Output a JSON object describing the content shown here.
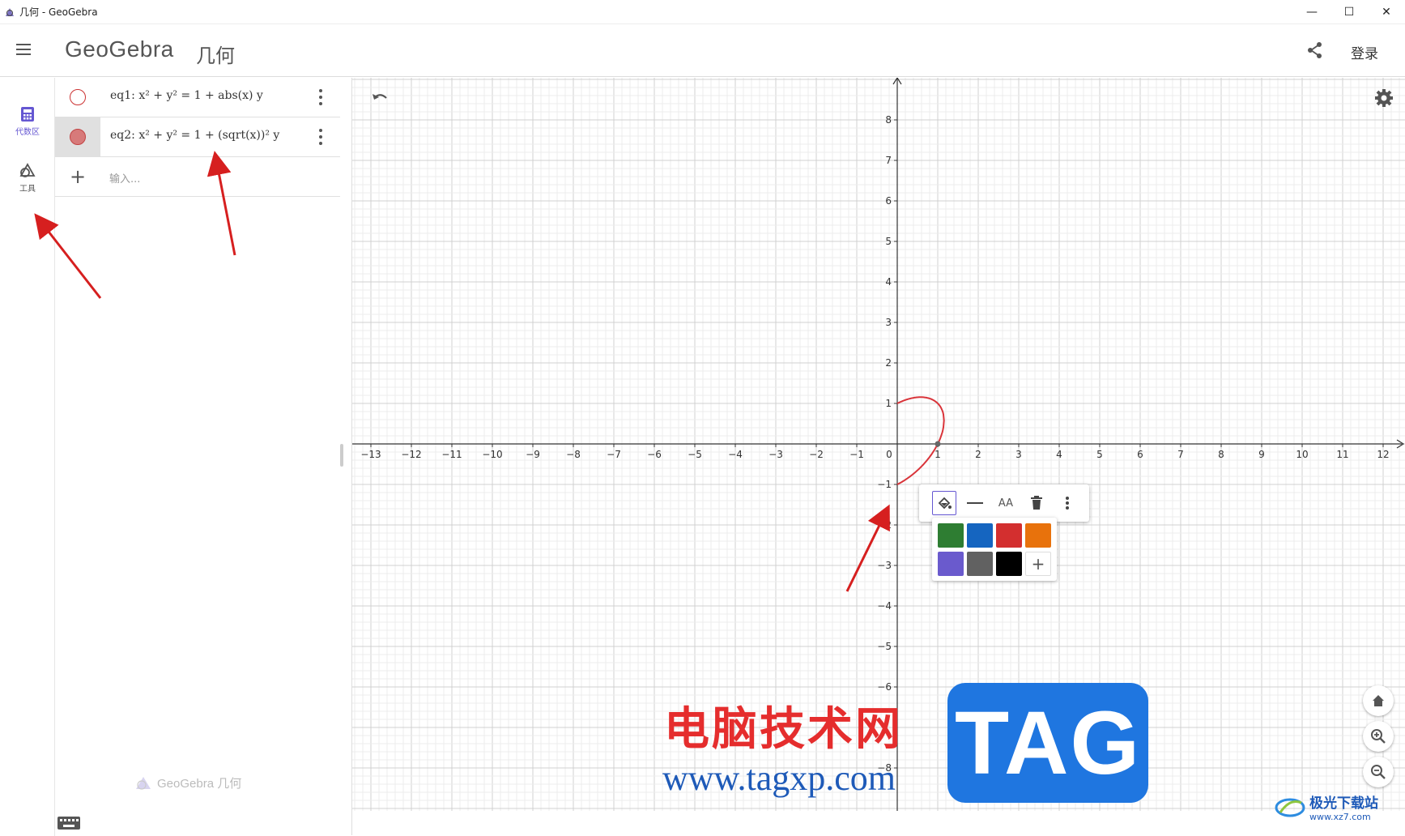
{
  "window": {
    "title": "几何 - GeoGebra",
    "controls": {
      "minimize": "—",
      "maximize": "☐",
      "close": "✕"
    }
  },
  "header": {
    "logo": "GeoGebra",
    "app_name": "几何",
    "login": "登录"
  },
  "rail": {
    "items": [
      {
        "label": "代数区",
        "icon": "calculator-icon",
        "active": true
      },
      {
        "label": "工具",
        "icon": "shapes-icon",
        "active": false
      }
    ]
  },
  "algebra": {
    "rows": [
      {
        "name": "eq1",
        "text": "eq1: x² + y² = 1 + abs(x) y",
        "marble_color": "#cc3333",
        "visible": false
      },
      {
        "name": "eq2",
        "text": "eq2: x² + y² = 1 + (sqrt(x))² y",
        "marble_color": "#d77a7a",
        "visible": true
      }
    ],
    "input_placeholder": "输入...",
    "footer_logo": "GeoGebra 几何"
  },
  "graphics": {
    "x_ticks": [
      "−13",
      "−12",
      "−11",
      "−10",
      "−9",
      "−8",
      "−7",
      "−6",
      "−5",
      "−4",
      "−3",
      "−2",
      "−1",
      "0",
      "1",
      "2",
      "3",
      "4",
      "5",
      "6",
      "7",
      "8",
      "9",
      "10",
      "11",
      "12"
    ],
    "y_ticks": [
      "8",
      "7",
      "6",
      "5",
      "4",
      "3",
      "2",
      "1",
      "−1",
      "−2",
      "−3",
      "−4",
      "−5",
      "−6",
      "−8"
    ],
    "x_range": [
      -13,
      12
    ],
    "y_range": [
      -9,
      8
    ],
    "curve_color": "#d9343a"
  },
  "stylebar": {
    "buttons": [
      "fill-color-icon",
      "line-style-icon",
      "text-size-icon",
      "delete-icon",
      "more-icon"
    ],
    "text_size_label": "AA",
    "palette_colors": [
      "#2e7d32",
      "#1565c0",
      "#d32f2f",
      "#e8720c",
      "#6a5acd",
      "#616161",
      "#000000"
    ],
    "palette_more": "+"
  },
  "watermark": {
    "cn": "电脑技术网",
    "url": "www.tagxp.com",
    "tag": "TAG",
    "corner_cn": "极光下载站",
    "corner_url": "www.xz7.com"
  },
  "colors": {
    "accent": "#6557d2",
    "annotation_arrow": "#d61f1f"
  }
}
